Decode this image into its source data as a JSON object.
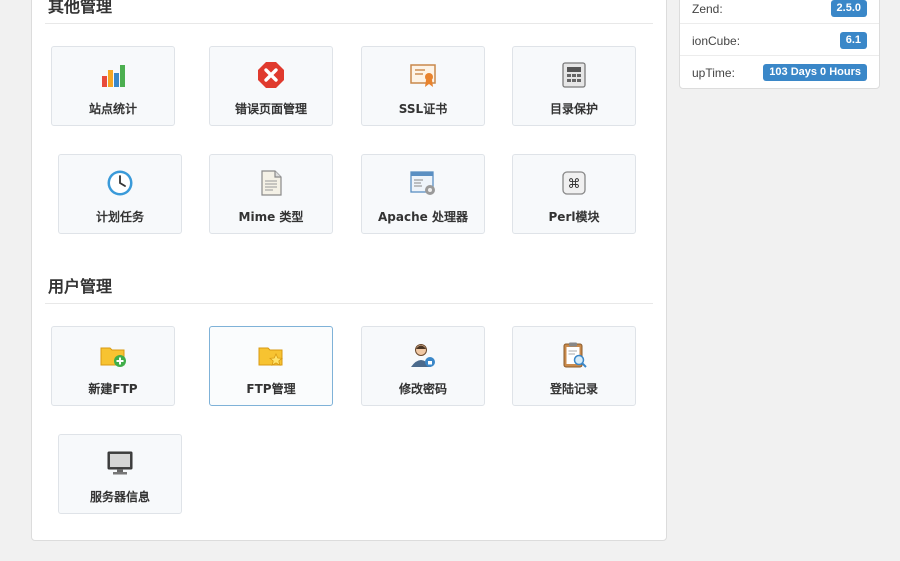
{
  "sections": {
    "other_title": "其他管理",
    "user_title": "用户管理"
  },
  "other_tiles": [
    {
      "label": "站点统计",
      "icon": "bar-chart-icon"
    },
    {
      "label": "错误页面管理",
      "icon": "error-icon"
    },
    {
      "label": "SSL证书",
      "icon": "certificate-icon"
    },
    {
      "label": "目录保护",
      "icon": "directory-protect-icon"
    },
    {
      "label": "计划任务",
      "icon": "clock-icon"
    },
    {
      "label": "Mime 类型",
      "icon": "document-icon"
    },
    {
      "label": "Apache 处理器",
      "icon": "window-gear-icon"
    },
    {
      "label": "Perl模块",
      "icon": "command-key-icon"
    }
  ],
  "user_tiles": [
    {
      "label": "新建FTP",
      "icon": "folder-add-icon"
    },
    {
      "label": "FTP管理",
      "icon": "folder-star-icon"
    },
    {
      "label": "修改密码",
      "icon": "user-lock-icon"
    },
    {
      "label": "登陆记录",
      "icon": "clipboard-search-icon"
    },
    {
      "label": "服务器信息",
      "icon": "monitor-icon"
    }
  ],
  "server_info": [
    {
      "key": "Zend:",
      "value": "2.5.0"
    },
    {
      "key": "ionCube:",
      "value": "6.1"
    },
    {
      "key": "upTime:",
      "value": "103 Days 0 Hours"
    }
  ],
  "colors": {
    "badge": "#3a87c8",
    "tile_bg": "#f7f9fb",
    "active_border": "#7fb2d8"
  }
}
